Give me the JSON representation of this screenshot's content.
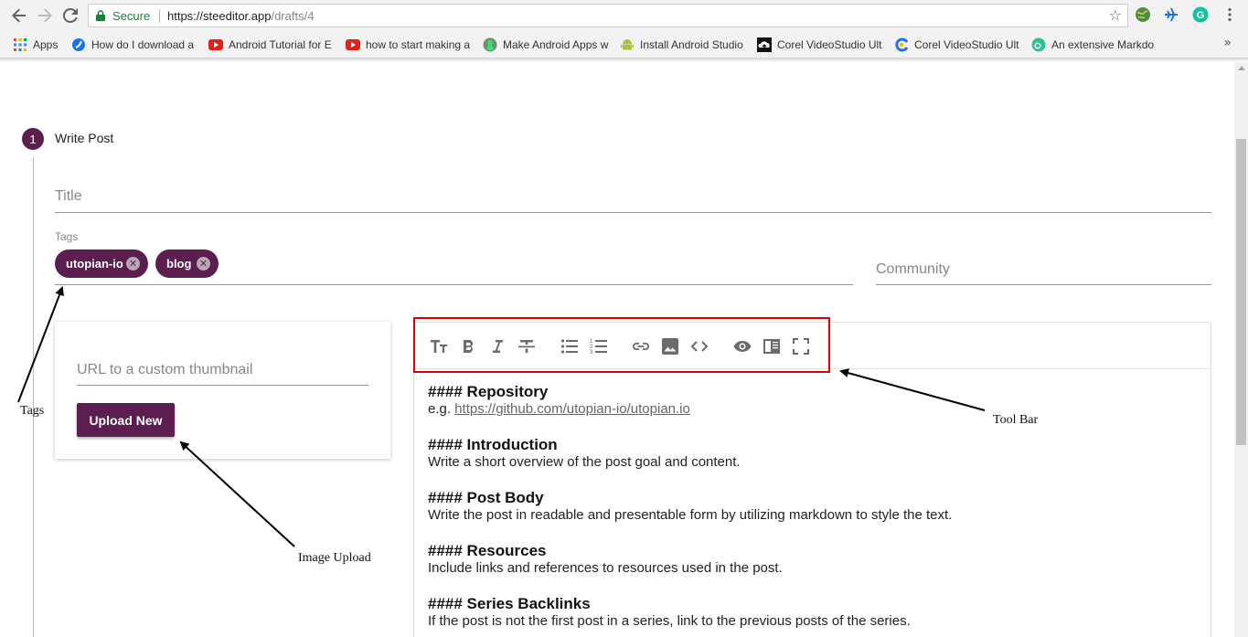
{
  "browser": {
    "secure_label": "Secure",
    "url_scheme_host": "https://steeditor.app",
    "url_path": "/drafts/4",
    "bookmarks": [
      {
        "label": "Apps",
        "icon": "apps-grid-icon"
      },
      {
        "label": "How do I download a",
        "icon": "chrome-blue-icon"
      },
      {
        "label": "Android Tutorial for E",
        "icon": "youtube-icon"
      },
      {
        "label": "how to start making a",
        "icon": "youtube-icon"
      },
      {
        "label": "Make Android Apps w",
        "icon": "android-avatar-icon"
      },
      {
        "label": "Install Android Studio",
        "icon": "android-icon"
      },
      {
        "label": "Corel VideoStudio Ult",
        "icon": "cloud-upload-icon"
      },
      {
        "label": "Corel VideoStudio Ult",
        "icon": "corel-icon"
      },
      {
        "label": "An extensive Markdo",
        "icon": "green-circle-icon"
      }
    ],
    "more_label": "»"
  },
  "stepper": {
    "number": "1",
    "label": "Write Post"
  },
  "form": {
    "title_placeholder": "Title",
    "tags_label": "Tags",
    "tags": [
      {
        "label": "utopian-io"
      },
      {
        "label": "blog"
      }
    ],
    "community_placeholder": "Community",
    "thumbnail_placeholder": "URL to a custom thumbnail",
    "upload_label": "Upload New"
  },
  "toolbar": {
    "icons": [
      "heading-icon",
      "bold-icon",
      "italic-icon",
      "strikethrough-icon",
      "bulleted-list-icon",
      "numbered-list-icon",
      "link-icon",
      "image-icon",
      "code-icon",
      "preview-eye-icon",
      "side-by-side-icon",
      "fullscreen-icon"
    ]
  },
  "editor": {
    "blocks": [
      {
        "heading": "#### Repository",
        "text_prefix": "e.g. ",
        "link": "https://github.com/utopian-io/utopian.io"
      },
      {
        "heading": "#### Introduction",
        "text": "Write a short overview of the post goal and content."
      },
      {
        "heading": "#### Post Body",
        "text": "Write the post in readable and presentable form by utilizing markdown to style the text."
      },
      {
        "heading": "#### Resources",
        "text": "Include links and references to resources used in the post."
      },
      {
        "heading": "#### Series Backlinks",
        "text": "If the post is not the first post in a series, link to the previous posts of the series."
      }
    ]
  },
  "annotations": {
    "tags": "Tags",
    "toolbar": "Tool Bar",
    "image_upload": "Image Upload"
  },
  "colors": {
    "brand": "#5c1e4f",
    "annotation_box": "#e00000"
  }
}
